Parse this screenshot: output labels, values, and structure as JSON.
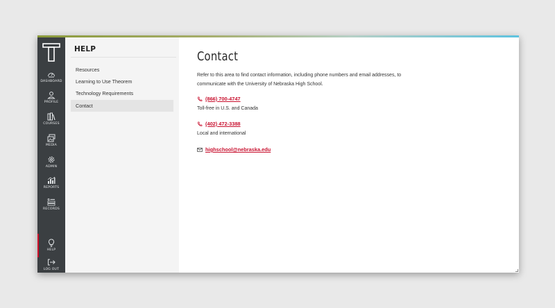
{
  "colors": {
    "rail": "#3b3f42",
    "accent_red": "#c8102e",
    "panel": "#f4f4f4"
  },
  "logo_icon": "theorem-t-logo",
  "nav": {
    "items": [
      {
        "label": "DASHBOARD",
        "icon": "dashboard-gauge-icon"
      },
      {
        "label": "PROFILE",
        "icon": "person-icon"
      },
      {
        "label": "COURSES",
        "icon": "books-icon"
      },
      {
        "label": "MEDIA",
        "icon": "media-icon"
      },
      {
        "label": "ADMIN",
        "icon": "gear-icon"
      },
      {
        "label": "REPORTS",
        "icon": "bar-chart-icon"
      },
      {
        "label": "RECORDS",
        "icon": "records-list-icon"
      }
    ],
    "help": {
      "label": "HELP",
      "icon": "lightbulb-icon"
    },
    "logout": {
      "label": "LOG OUT",
      "icon": "logout-arrow-icon"
    }
  },
  "help_panel": {
    "title": "HELP",
    "links": [
      "Resources",
      "Learning to Use Theorem",
      "Technology Requirements",
      "Contact"
    ],
    "selected": "Contact"
  },
  "main": {
    "title": "Contact",
    "intro": "Refer to this area to find contact information, including phone numbers and email addresses, to communicate with the University of Nebraska High School.",
    "phone1": {
      "number": "(866) 700-4747",
      "note": "Toll-free in U.S. and Canada",
      "icon": "phone-icon"
    },
    "phone2": {
      "number": "(402) 472-3388",
      "note": "Local and international",
      "icon": "phone-icon"
    },
    "email": {
      "address": "highschool@nebraska.edu",
      "icon": "envelope-icon"
    }
  }
}
